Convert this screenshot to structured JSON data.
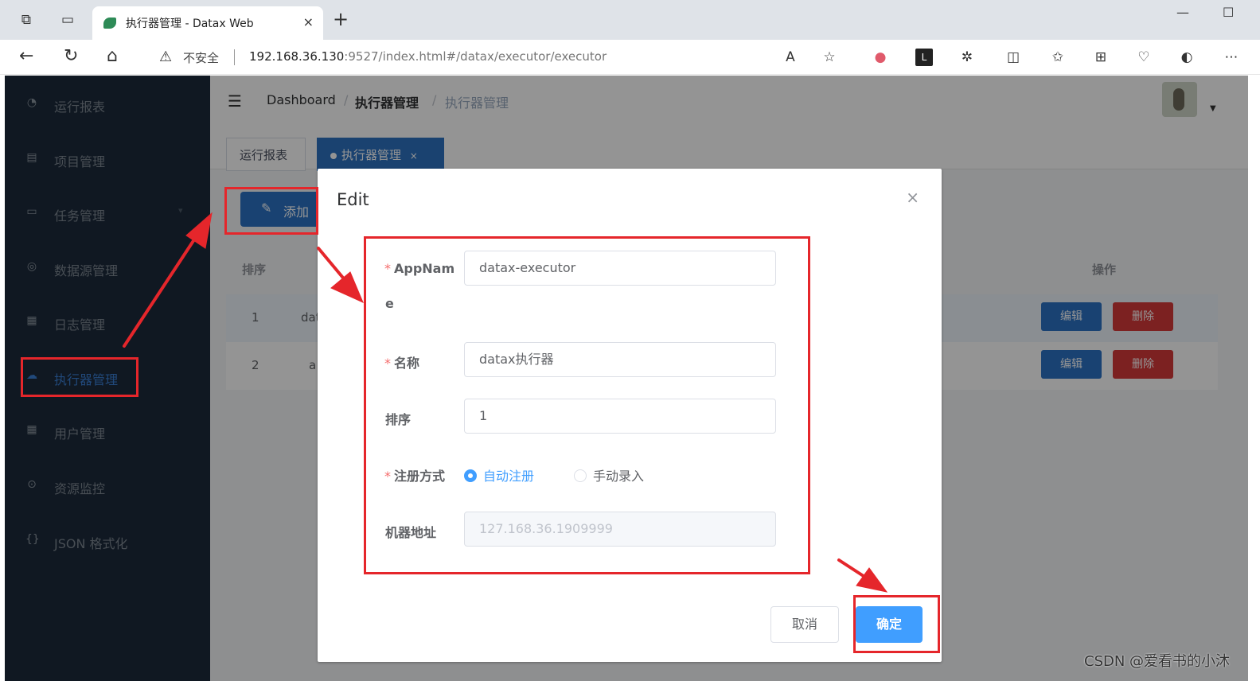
{
  "browser": {
    "tab_title": "执行器管理 - Datax Web",
    "tab_close": "×",
    "new_tab": "+",
    "security_label": "不安全",
    "url_host": "192.168.36.130",
    "url_rest": ":9527/index.html#/datax/executor/executor"
  },
  "sidebar": {
    "items": [
      {
        "label": "运行报表",
        "icon": "dashboard-icon"
      },
      {
        "label": "项目管理",
        "icon": "project-icon"
      },
      {
        "label": "任务管理",
        "icon": "monitor-icon"
      },
      {
        "label": "数据源管理",
        "icon": "database-icon"
      },
      {
        "label": "日志管理",
        "icon": "document-icon"
      },
      {
        "label": "执行器管理",
        "icon": "cloud-icon"
      },
      {
        "label": "用户管理",
        "icon": "table-icon"
      },
      {
        "label": "资源监控",
        "icon": "link-icon"
      },
      {
        "label": "JSON 格式化",
        "icon": "braces-icon"
      }
    ]
  },
  "breadcrumb": {
    "items": [
      "Dashboard",
      "执行器管理",
      "执行器管理"
    ],
    "separator": "/"
  },
  "tags": {
    "items": [
      "运行报表",
      "执行器管理"
    ],
    "close": "×"
  },
  "toolbar": {
    "add_label": "添加"
  },
  "table": {
    "headers": {
      "order": "排序",
      "actions": "操作"
    },
    "rows": [
      {
        "order": "1",
        "appname": "dat",
        "edit": "编辑",
        "delete": "删除"
      },
      {
        "order": "2",
        "appname": "a",
        "edit": "编辑",
        "delete": "删除"
      }
    ]
  },
  "dialog": {
    "title": "Edit",
    "close": "×",
    "fields": {
      "appname_label_line1": "AppNam",
      "appname_label_line2": "e",
      "appname_value": "datax-executor",
      "name_label": "名称",
      "name_value": "datax执行器",
      "order_label": "排序",
      "order_value": "1",
      "register_label": "注册方式",
      "register_auto": "自动注册",
      "register_manual": "手动录入",
      "address_label": "机器地址",
      "address_value": "127.168.36.1909999"
    },
    "required_mark": "*",
    "cancel_label": "取消",
    "confirm_label": "确定"
  },
  "watermark": "CSDN @爱看书的小沐",
  "colors": {
    "sidebar_bg": "#1c2a3b",
    "primary": "#409eff",
    "danger": "#d6393a",
    "annotation": "#e5262b"
  }
}
